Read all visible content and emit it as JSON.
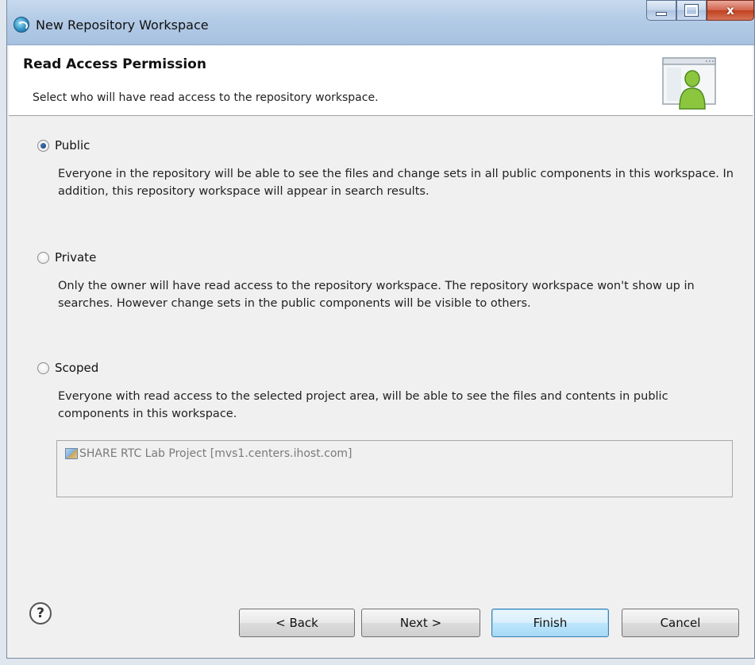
{
  "window": {
    "title": "New Repository Workspace",
    "controls": {
      "minimize": "minimize",
      "maximize": "maximize",
      "close": "x"
    }
  },
  "header": {
    "title": "Read Access Permission",
    "description": "Select who will have read access to the repository workspace.",
    "icon": "user-window-icon"
  },
  "options": [
    {
      "label": "Public",
      "checked": true,
      "description": "Everyone in the repository will be able to see the files and change sets in all public components in this workspace. In addition, this repository workspace will appear in search results."
    },
    {
      "label": "Private",
      "checked": false,
      "description": "Only the owner will have read access to the repository workspace. The repository workspace won't show up in searches. However change sets in the public components will be visible to others."
    },
    {
      "label": "Scoped",
      "checked": false,
      "description": "Everyone with read access to the selected project area, will be able to see the files and contents in public components in this workspace."
    }
  ],
  "project_area": {
    "item_label": "SHARE RTC Lab Project [mvs1.centers.ihost.com]",
    "icon": "project-area-icon"
  },
  "buttons": {
    "help": "?",
    "back": "< Back",
    "next": "Next >",
    "finish": "Finish",
    "cancel": "Cancel"
  }
}
